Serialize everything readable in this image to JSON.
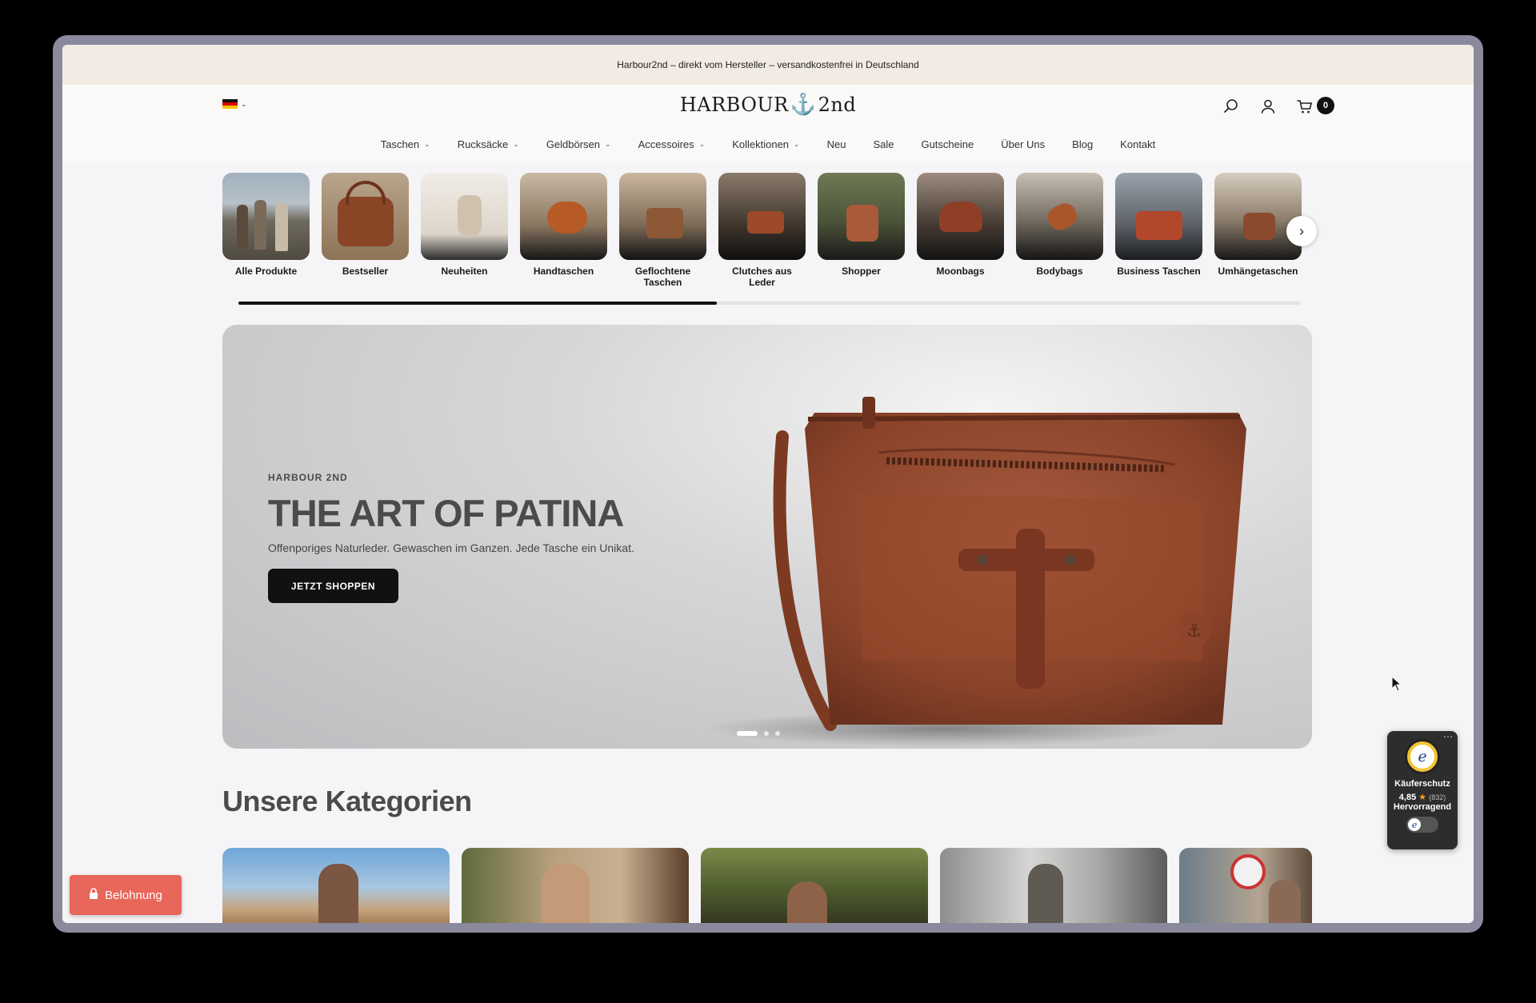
{
  "announcement": "Harbour2nd – direkt vom Hersteller – versandkostenfrei in Deutschland",
  "header": {
    "logo_left": "HARBOUR",
    "logo_right": "2nd",
    "cart_count": "0"
  },
  "nav": {
    "items": [
      {
        "label": "Taschen",
        "dropdown": true
      },
      {
        "label": "Rucksäcke",
        "dropdown": true
      },
      {
        "label": "Geldbörsen",
        "dropdown": true
      },
      {
        "label": "Accessoires",
        "dropdown": true
      },
      {
        "label": "Kollektionen",
        "dropdown": true
      },
      {
        "label": "Neu",
        "dropdown": false
      },
      {
        "label": "Sale",
        "dropdown": false
      },
      {
        "label": "Gutscheine",
        "dropdown": false
      },
      {
        "label": "Über Uns",
        "dropdown": false
      },
      {
        "label": "Blog",
        "dropdown": false
      },
      {
        "label": "Kontakt",
        "dropdown": false
      }
    ]
  },
  "categories": [
    {
      "label": "Alle Produkte"
    },
    {
      "label": "Bestseller"
    },
    {
      "label": "Neuheiten"
    },
    {
      "label": "Handtaschen"
    },
    {
      "label": "Geflochtene Taschen"
    },
    {
      "label": "Clutches aus Leder"
    },
    {
      "label": "Shopper"
    },
    {
      "label": "Moonbags"
    },
    {
      "label": "Bodybags"
    },
    {
      "label": "Business Taschen"
    },
    {
      "label": "Umhängetaschen"
    }
  ],
  "category_scroll_progress": 0.45,
  "hero": {
    "eyebrow": "HARBOUR 2ND",
    "title": "THE ART OF PATINA",
    "subtitle": "Offenporiges Naturleder. Gewaschen im Ganzen. Jede Tasche ein Unikat.",
    "cta": "JETZT SHOPPEN",
    "slides": 3,
    "active_slide": 1
  },
  "section_title": "Unsere Kategorien",
  "trust_badge": {
    "label": "Käuferschutz",
    "rating": "4,85",
    "count": "(832)",
    "verdict": "Hervorragend"
  },
  "reward": {
    "label": "Belohnung"
  },
  "colors": {
    "accent": "#e8665a",
    "announcement_bg": "#f2ebe3",
    "logo_anchor": "#e36b55"
  }
}
